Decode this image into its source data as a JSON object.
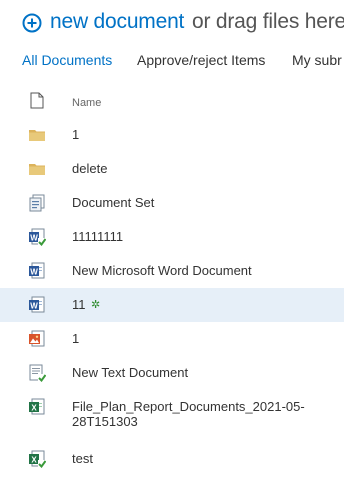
{
  "toolbar": {
    "new_document_label": "new document",
    "drag_text": "or drag files here"
  },
  "views": [
    {
      "label": "All Documents",
      "active": true
    },
    {
      "label": "Approve/reject Items",
      "active": false
    },
    {
      "label": "My subr",
      "active": false
    }
  ],
  "columns": {
    "name": "Name"
  },
  "items": [
    {
      "name": "1",
      "icon": "folder-icon"
    },
    {
      "name": "delete",
      "icon": "folder-icon"
    },
    {
      "name": "Document Set",
      "icon": "document-set-icon"
    },
    {
      "name": "11111111",
      "icon": "word-document-checked-icon"
    },
    {
      "name": "New Microsoft Word Document",
      "icon": "word-document-icon"
    },
    {
      "name": "11",
      "icon": "word-document-icon",
      "badge": "✲",
      "selected": true
    },
    {
      "name": "1",
      "icon": "image-file-icon"
    },
    {
      "name": "New Text Document",
      "icon": "text-document-checked-icon"
    },
    {
      "name_line1": "File_Plan_Report_Documents_2021-05-",
      "name_line2": "28T151303",
      "icon": "excel-document-icon"
    },
    {
      "name": "test",
      "icon": "excel-document-checked-icon"
    }
  ],
  "colors": {
    "accent": "#0072c6",
    "selected_row": "#e6eff8",
    "folder": "#dcb35c",
    "word": "#2b579a",
    "excel": "#217346",
    "checkmark": "#3a9a3a"
  }
}
